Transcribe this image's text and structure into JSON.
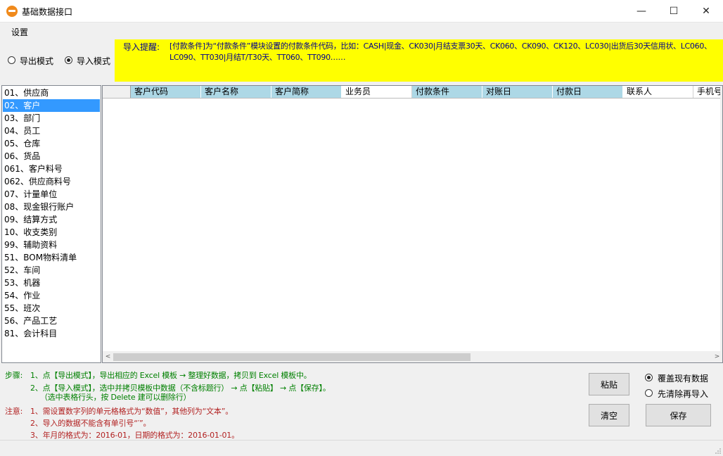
{
  "window": {
    "title": "基础数据接口",
    "minimize": "—",
    "maximize": "☐",
    "close": "✕"
  },
  "menu": {
    "settings": "设置"
  },
  "mode": {
    "export_label": "导出模式",
    "import_label": "导入模式",
    "selected": "import"
  },
  "hint": {
    "label": "导入提醒:",
    "text": "[付款条件]为“付款条件”模块设置的付款条件代码，比如：CASH|现金、CK030|月结支票30天、CK060、CK090、CK120、LC030|出货后30天信用状、LC060、LC090、TT030|月结T/T30天、TT060、TT090……"
  },
  "categories": {
    "items": [
      "01、供应商",
      "02、客户",
      "03、部门",
      "04、员工",
      "05、仓库",
      "06、货品",
      "061、客户料号",
      "062、供应商料号",
      "07、计量单位",
      "08、现金银行账户",
      "09、结算方式",
      "10、收支类别",
      "99、辅助资料",
      "51、BOM物料清单",
      "52、车间",
      "53、机器",
      "54、作业",
      "55、班次",
      "56、产品工艺",
      "81、会计科目"
    ],
    "selected_index": 1
  },
  "grid": {
    "columns": [
      "客户代码",
      "客户名称",
      "客户简称",
      "业务员",
      "付款条件",
      "对账日",
      "付款日",
      "联系人",
      "手机号"
    ],
    "highlight_columns": [
      0,
      1,
      2,
      4,
      5,
      6
    ],
    "scroll_left_arrow": "<",
    "scroll_right_arrow": ">"
  },
  "instructions": {
    "steps_label": "步骤:",
    "step1": "1、点【导出模式】，导出相应的 Excel 模板 → 整理好数据，拷贝到 Excel 模板中。",
    "step2": "2、点【导入模式】，选中并拷贝模板中数据（不含标题行） → 点【粘贴】 → 点【保存】。",
    "step2_sub": "（选中表格行头，按 Delete 建可以删除行）",
    "notes_label": "注意:",
    "note1": "1、需设置数字列的单元格格式为“数值”，其他列为“文本”。",
    "note2": "2、导入的数据不能含有单引号“′”。",
    "note3": "3、年月的格式为：2016-01，日期的格式为：2016-01-01。"
  },
  "actions": {
    "paste": "粘贴",
    "clear": "清空",
    "save": "保存",
    "overwrite_label": "覆盖现有数据",
    "clear_first_label": "先清除再导入",
    "selected": "overwrite"
  },
  "colors": {
    "hint_bg": "#ffff00",
    "hint_text": "#00008b",
    "header_blue": "#add8e6",
    "selection": "#3399ff",
    "steps_text": "#008000",
    "notes_text": "#b22222"
  }
}
